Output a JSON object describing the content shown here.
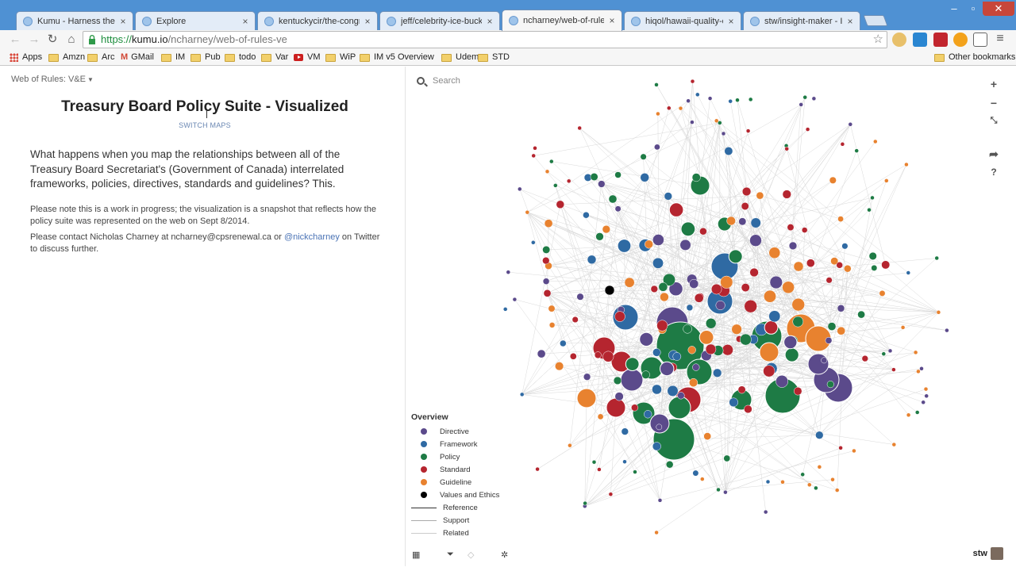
{
  "browser": {
    "tabs": [
      {
        "title": "Kumu - Harness the pow…",
        "active": false
      },
      {
        "title": "Explore",
        "active": false
      },
      {
        "title": "kentuckycir/the-congress",
        "active": false
      },
      {
        "title": "jeff/celebrity-ice-bucket-",
        "active": false
      },
      {
        "title": "ncharney/web-of-rules-ve",
        "active": true
      },
      {
        "title": "hiqol/hawaii-quality-of-li",
        "active": false
      },
      {
        "title": "stw/insight-maker - Insig",
        "active": false
      }
    ],
    "url_protocol": "https://",
    "url_host": "kumu.io",
    "url_path": "/ncharney/web-of-rules-ve",
    "bookmarks": [
      {
        "label": "Apps",
        "icon": "apps-icon"
      },
      {
        "label": "Amzn",
        "icon": "folder-icon"
      },
      {
        "label": "Arc",
        "icon": "folder-icon"
      },
      {
        "label": "GMail",
        "icon": "gmail-icon"
      },
      {
        "label": "IM",
        "icon": "folder-icon"
      },
      {
        "label": "Pub",
        "icon": "folder-icon"
      },
      {
        "label": "todo",
        "icon": "folder-icon"
      },
      {
        "label": "Var",
        "icon": "folder-icon"
      },
      {
        "label": "VM",
        "icon": "youtube-icon"
      },
      {
        "label": "WiP",
        "icon": "folder-icon"
      },
      {
        "label": "IM v5 Overview",
        "icon": "folder-icon"
      },
      {
        "label": "Udemy",
        "icon": "folder-icon"
      },
      {
        "label": "STD",
        "icon": "folder-icon"
      }
    ],
    "other_bookmarks": "Other bookmarks"
  },
  "left": {
    "map_selector": "Web of Rules: V&E",
    "title": "Treasury Board Policy Suite - Visualized",
    "switch_maps": "SWITCH MAPS",
    "lead": "What happens when you map the relationships between all of the Treasury Board Secretariat's (Government of Canada) interrelated frameworks, policies, directives, standards and guidelines? This.",
    "note1": "Please note this is a work in progress; the visualization is a snapshot that reflects how the policy suite was represented on the web on Sept 8/2014.",
    "note2_prefix": "Please contact Nicholas Charney at ncharney@cpsrenewal.ca or",
    "note2_link": "@nickcharney",
    "note2_suffix": "on Twitter to discuss further."
  },
  "map": {
    "search_placeholder": "Search",
    "legend_title": "Overview",
    "legend_nodes": [
      {
        "label": "Directive",
        "color": "#5b4a8b"
      },
      {
        "label": "Framework",
        "color": "#2f6aa3"
      },
      {
        "label": "Policy",
        "color": "#1e7b45"
      },
      {
        "label": "Standard",
        "color": "#b5252f"
      },
      {
        "label": "Guideline",
        "color": "#e8822f"
      },
      {
        "label": "Values and Ethics",
        "color": "#000000"
      }
    ],
    "legend_edges": [
      {
        "label": "Reference",
        "color": "#333333"
      },
      {
        "label": "Support",
        "color": "#aaaaaa"
      },
      {
        "label": "Related",
        "color": "#cccccc"
      }
    ],
    "user": "stw"
  }
}
